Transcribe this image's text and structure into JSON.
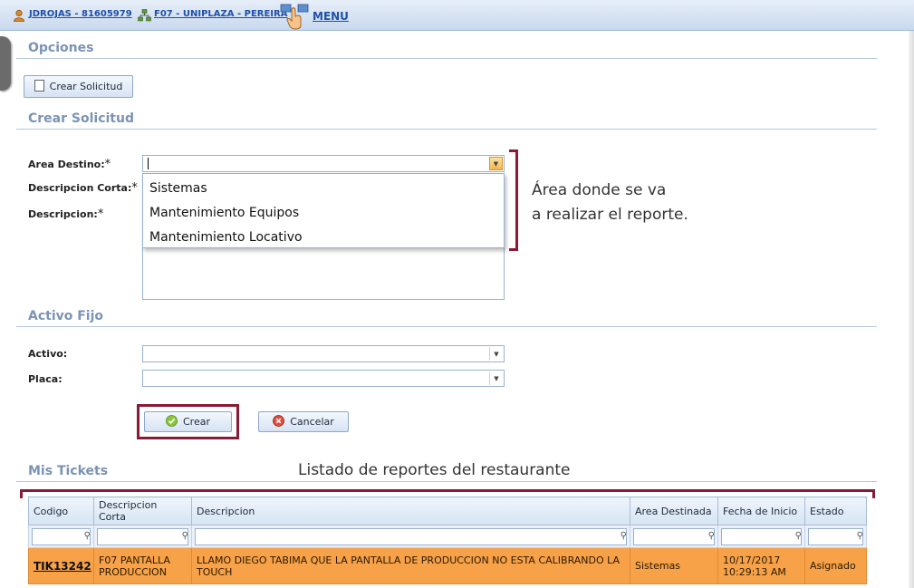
{
  "topbar": {
    "user_label": "JDROJAS - 81605979",
    "store_label": "F07 - UNIPLAZA - PEREIRA",
    "menu_label": "MENU"
  },
  "options": {
    "title": "Opciones",
    "create_button": "Crear Solicitud"
  },
  "create_request": {
    "title": "Crear Solicitud",
    "area_label": "Area Destino:",
    "short_desc_label": "Descripcion Corta:",
    "desc_label": "Descripcion:",
    "required_mark": "*",
    "area_value": "",
    "area_options": [
      "Sistemas",
      "Mantenimiento Equipos",
      "Mantenimiento Locativo"
    ]
  },
  "fixed_asset": {
    "title": "Activo Fijo",
    "asset_label": "Activo:",
    "plate_label": "Placa:"
  },
  "actions": {
    "create_label": "Crear",
    "cancel_label": "Cancelar"
  },
  "annotations": {
    "area_note_line1": "Área donde se va",
    "area_note_line2": "a realizar el reporte.",
    "table_note": "Listado de reportes del restaurante"
  },
  "tickets": {
    "title": "Mis Tickets",
    "columns": [
      "Codigo",
      "Descripcion Corta",
      "Descripcion",
      "Area Destinada",
      "Fecha de Inicio",
      "Estado"
    ],
    "rows": [
      {
        "code": "TIK13242",
        "short_desc": "F07 PANTALLA PRODUCCION",
        "desc": "LLAMO DIEGO TABIMA QUE LA PANTALLA DE PRODUCCION NO ESTA CALIBRANDO LA TOUCH",
        "area": "Sistemas",
        "date": "10/17/2017",
        "time": "10:29:13 AM",
        "status": "Asignado"
      }
    ]
  },
  "colors": {
    "accent": "#1f4fa8",
    "section_title": "#7b93b4",
    "highlight": "#8a1a35",
    "row_assigned": "#f7a148"
  }
}
